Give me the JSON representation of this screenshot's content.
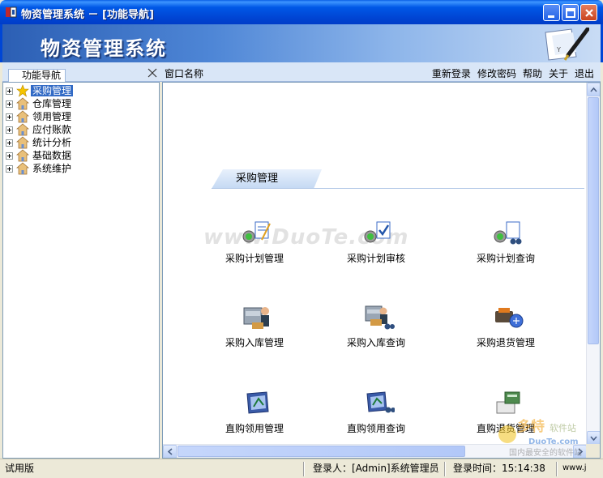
{
  "window": {
    "title": "物资管理系统 － [功能导航]"
  },
  "banner": {
    "title": "物资管理系统"
  },
  "toolbar": {
    "nav_tab": "功能导航",
    "window_name": "窗口名称",
    "links": [
      "重新登录",
      "修改密码",
      "帮助",
      "关于",
      "退出"
    ]
  },
  "tree": {
    "items": [
      {
        "label": "采购管理",
        "icon": "star-icon",
        "selected": true
      },
      {
        "label": "仓库管理",
        "icon": "house-icon",
        "selected": false
      },
      {
        "label": "领用管理",
        "icon": "house-icon",
        "selected": false
      },
      {
        "label": "应付账款",
        "icon": "house-icon",
        "selected": false
      },
      {
        "label": "统计分析",
        "icon": "house-icon",
        "selected": false
      },
      {
        "label": "基础数据",
        "icon": "house-icon",
        "selected": false
      },
      {
        "label": "系统维护",
        "icon": "house-icon",
        "selected": false
      }
    ]
  },
  "content": {
    "section_title": "采购管理",
    "watermark": "www.DuoTe.com",
    "functions": [
      {
        "label": "采购计划管理",
        "icon": "plan-manage-icon"
      },
      {
        "label": "采购计划审核",
        "icon": "plan-audit-icon"
      },
      {
        "label": "采购计划查询",
        "icon": "plan-query-icon"
      },
      {
        "label": "采购入库管理",
        "icon": "stock-in-manage-icon"
      },
      {
        "label": "采购入库查询",
        "icon": "stock-in-query-icon"
      },
      {
        "label": "采购退货管理",
        "icon": "return-manage-icon"
      },
      {
        "label": "直购领用管理",
        "icon": "direct-use-manage-icon"
      },
      {
        "label": "直购领用查询",
        "icon": "direct-use-query-icon"
      },
      {
        "label": "直购退货管理",
        "icon": "direct-return-icon"
      }
    ]
  },
  "statusbar": {
    "mode": "试用版",
    "user": "登录人：[Admin]系统管理员",
    "login_time": "登录时间：15:14:38",
    "site": "www.j"
  },
  "corner_watermark": {
    "brand": "多特",
    "sub": "软件站",
    "domain": "DuoTe.com",
    "note": "国内最安全的软件站"
  }
}
